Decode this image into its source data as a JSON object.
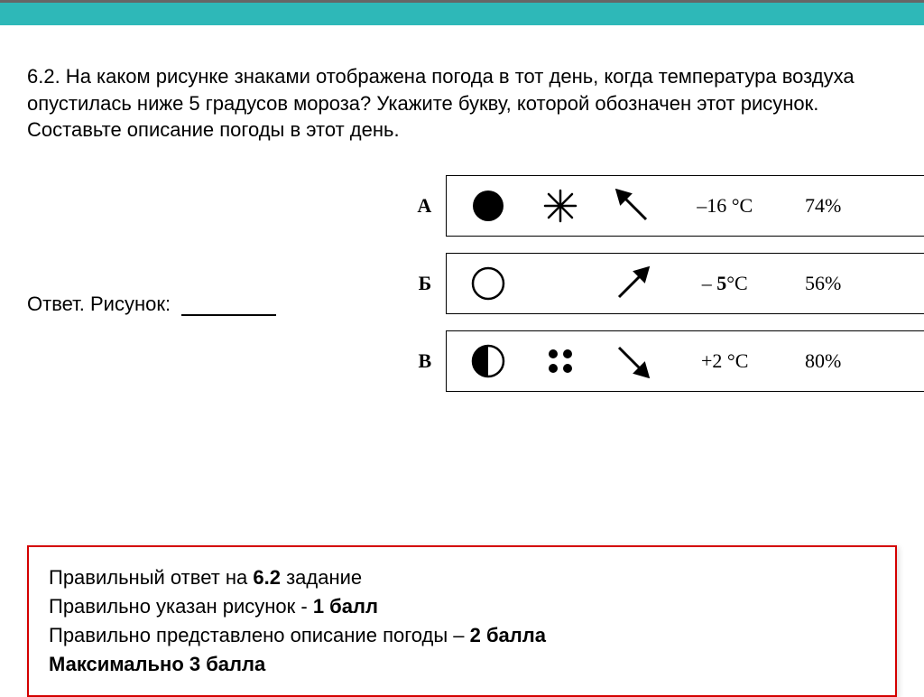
{
  "question": "6.2. На каком рисунке знаками отображена погода в тот день, когда температура воздуха опустилась ниже 5 градусов мороза? Укажите букву, которой обозначен этот рисунок. Составьте описание погоды в этот день.",
  "options": [
    {
      "label": "А",
      "cloud": "full-circle",
      "precip": "snow",
      "wind": "arrow-nw",
      "temperature": "–16 °C",
      "humidity": "74%"
    },
    {
      "label": "Б",
      "cloud": "empty-circle",
      "precip": "none",
      "wind": "arrow-ne",
      "temperature_prefix": "– ",
      "temperature_bold": "5",
      "temperature_suffix": "°C",
      "humidity": "56%"
    },
    {
      "label": "В",
      "cloud": "half-circle",
      "precip": "dots",
      "wind": "arrow-se",
      "temperature": "+2 °C",
      "humidity": "80%"
    }
  ],
  "answer_label": "Ответ. Рисунок:",
  "correct": {
    "line1_a": "Правильный ответ на ",
    "line1_b": "6.2",
    "line1_c": " задание",
    "line2_a": "Правильно указан рисунок - ",
    "line2_b": "1 балл",
    "line3_a": "Правильно представлено описание погоды – ",
    "line3_b": "2 балла",
    "line4": "Максимально 3 балла"
  }
}
